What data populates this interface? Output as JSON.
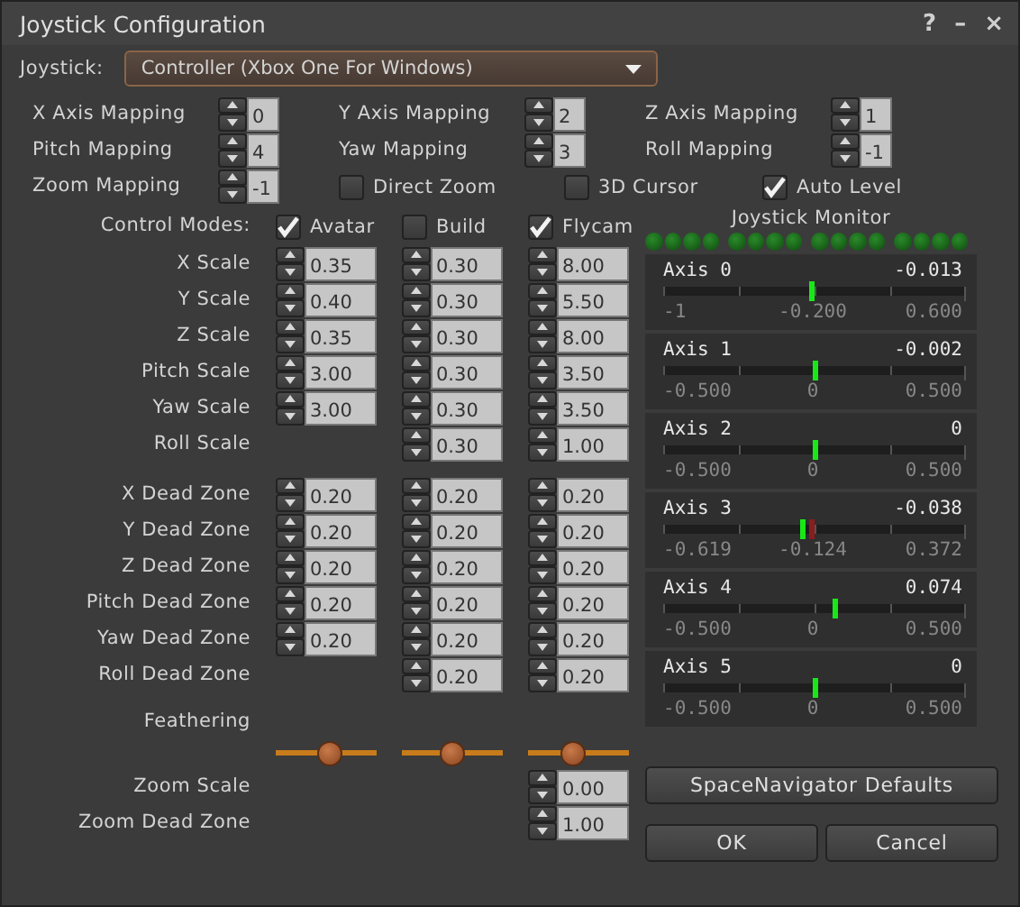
{
  "window": {
    "title": "Joystick Configuration",
    "controls": [
      "?",
      "–",
      "×"
    ]
  },
  "joystick": {
    "label": "Joystick:",
    "value": "Controller (Xbox One For Windows)"
  },
  "mappings": [
    {
      "label": "X Axis Mapping",
      "value": "0"
    },
    {
      "label": "Y Axis Mapping",
      "value": "2"
    },
    {
      "label": "Z Axis Mapping",
      "value": "1"
    },
    {
      "label": "Pitch Mapping",
      "value": "4"
    },
    {
      "label": "Yaw Mapping",
      "value": "3"
    },
    {
      "label": "Roll Mapping",
      "value": "-1"
    },
    {
      "label": "Zoom Mapping",
      "value": "-1"
    }
  ],
  "options": [
    {
      "label": "Direct Zoom",
      "checked": false
    },
    {
      "label": "3D Cursor",
      "checked": false
    },
    {
      "label": "Auto Level",
      "checked": true
    }
  ],
  "control_modes": {
    "label": "Control Modes:",
    "modes": [
      {
        "label": "Avatar",
        "checked": true
      },
      {
        "label": "Build",
        "checked": false
      },
      {
        "label": "Flycam",
        "checked": true
      }
    ]
  },
  "scales": [
    {
      "label": "X Scale",
      "avatar": "0.35",
      "build": "0.30",
      "flycam": "8.00"
    },
    {
      "label": "Y Scale",
      "avatar": "0.40",
      "build": "0.30",
      "flycam": "5.50"
    },
    {
      "label": "Z Scale",
      "avatar": "0.35",
      "build": "0.30",
      "flycam": "8.00"
    },
    {
      "label": "Pitch Scale",
      "avatar": "3.00",
      "build": "0.30",
      "flycam": "3.50"
    },
    {
      "label": "Yaw Scale",
      "avatar": "3.00",
      "build": "0.30",
      "flycam": "3.50"
    },
    {
      "label": "Roll Scale",
      "build": "0.30",
      "flycam": "1.00"
    }
  ],
  "dead_zones": [
    {
      "label": "X Dead Zone",
      "avatar": "0.20",
      "build": "0.20",
      "flycam": "0.20"
    },
    {
      "label": "Y Dead Zone",
      "avatar": "0.20",
      "build": "0.20",
      "flycam": "0.20"
    },
    {
      "label": "Z Dead Zone",
      "avatar": "0.20",
      "build": "0.20",
      "flycam": "0.20"
    },
    {
      "label": "Pitch Dead Zone",
      "avatar": "0.20",
      "build": "0.20",
      "flycam": "0.20"
    },
    {
      "label": "Yaw Dead Zone",
      "avatar": "0.20",
      "build": "0.20",
      "flycam": "0.20"
    },
    {
      "label": "Roll Dead Zone",
      "build": "0.20",
      "flycam": "0.20"
    }
  ],
  "feathering": {
    "label": "Feathering",
    "sliders": [
      {
        "level": 0.55
      },
      {
        "level": 0.5
      },
      {
        "level": 0.43
      }
    ]
  },
  "zoom": [
    {
      "label": "Zoom Scale",
      "flycam": "0.00"
    },
    {
      "label": "Zoom Dead Zone",
      "flycam": "1.00"
    }
  ],
  "monitor": {
    "title": "Joystick Monitor",
    "axes": [
      {
        "name": "Axis 0",
        "reading": "-0.013",
        "level": 0.49,
        "ticks": [
          "-1",
          "-0.200",
          "0.600"
        ]
      },
      {
        "name": "Axis 1",
        "reading": "-0.002",
        "level": 0.5,
        "ticks": [
          "-0.500",
          "0",
          "0.500"
        ]
      },
      {
        "name": "Axis 2",
        "reading": "0",
        "level": 0.5,
        "ticks": [
          "-0.500",
          "0",
          "0.500"
        ]
      },
      {
        "name": "Axis 3",
        "reading": "-0.038",
        "level": 0.46,
        "peak": {
          "level": 0.49
        },
        "ticks": [
          "-0.619",
          "-0.124",
          "0.372"
        ]
      },
      {
        "name": "Axis 4",
        "reading": "0.074",
        "level": 0.57,
        "ticks": [
          "-0.500",
          "0",
          "0.500"
        ]
      },
      {
        "name": "Axis 5",
        "reading": "0",
        "level": 0.5,
        "ticks": [
          "-0.500",
          "0",
          "0.500"
        ]
      }
    ]
  },
  "buttons": [
    {
      "label": "SpaceNavigator Defaults",
      "kind": "wide"
    },
    {
      "label": "OK",
      "kind": "half"
    },
    {
      "label": "Cancel",
      "kind": "half"
    }
  ]
}
